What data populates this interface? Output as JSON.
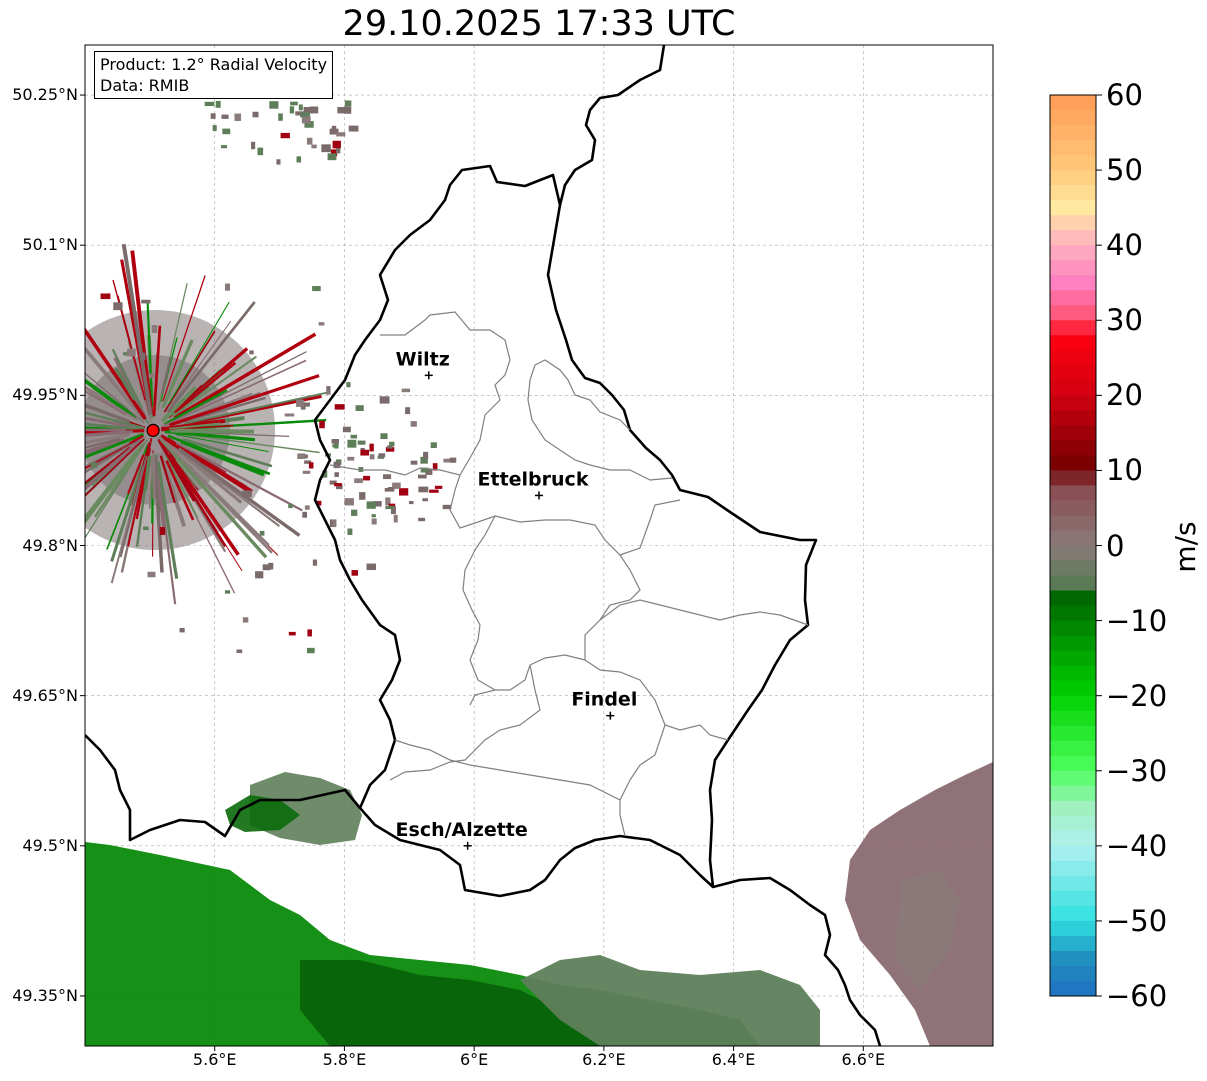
{
  "title": "29.10.2025 17:33 UTC",
  "info": {
    "product": "Product: 1.2° Radial Velocity",
    "data": "Data: RMIB"
  },
  "axes": {
    "lat_ticks": [
      "50.25°N",
      "50.1°N",
      "49.95°N",
      "49.8°N",
      "49.65°N",
      "49.5°N",
      "49.35°N"
    ],
    "lat_values": [
      50.25,
      50.1,
      49.95,
      49.8,
      49.65,
      49.5,
      49.35
    ],
    "lon_ticks": [
      "5.6°E",
      "5.8°E",
      "6°E",
      "6.2°E",
      "6.4°E",
      "6.6°E"
    ],
    "lon_values": [
      5.6,
      5.8,
      6.0,
      6.2,
      6.4,
      6.6
    ],
    "lon_range": [
      5.4,
      6.8
    ],
    "lat_range": [
      49.3,
      50.3
    ],
    "grid": true
  },
  "cities": [
    {
      "name": "Wiltz",
      "lon": 5.93,
      "lat": 49.97
    },
    {
      "name": "Ettelbruck",
      "lon": 6.1,
      "lat": 49.85
    },
    {
      "name": "Findel",
      "lon": 6.21,
      "lat": 49.63
    },
    {
      "name": "Esch/Alzette",
      "lon": 5.99,
      "lat": 49.5
    }
  ],
  "radar_site": {
    "lon": 5.505,
    "lat": 49.915
  },
  "colorbar": {
    "label": "m/s",
    "min": -60,
    "max": 60,
    "ticks": [
      "60",
      "50",
      "40",
      "30",
      "20",
      "10",
      "0",
      "−10",
      "−20",
      "−30",
      "−40",
      "−50",
      "−60"
    ],
    "stops": [
      {
        "value": 60,
        "color": "#ff9a55"
      },
      {
        "value": 50,
        "color": "#ffc97a"
      },
      {
        "value": 45,
        "color": "#ffe8a0"
      },
      {
        "value": 40,
        "color": "#ffb0c0"
      },
      {
        "value": 35,
        "color": "#ff80c0"
      },
      {
        "value": 30,
        "color": "#ff5070"
      },
      {
        "value": 28,
        "color": "#ff0010"
      },
      {
        "value": 20,
        "color": "#d00010"
      },
      {
        "value": 10,
        "color": "#700000"
      },
      {
        "value": 8,
        "color": "#8a4a50"
      },
      {
        "value": 0,
        "color": "#8a7a7a"
      },
      {
        "value": -5,
        "color": "#5a7a55"
      },
      {
        "value": -6,
        "color": "#006000"
      },
      {
        "value": -20,
        "color": "#00d000"
      },
      {
        "value": -30,
        "color": "#50ff60"
      },
      {
        "value": -35,
        "color": "#a0f0c0"
      },
      {
        "value": -40,
        "color": "#b0f0f0"
      },
      {
        "value": -50,
        "color": "#30e0e0"
      },
      {
        "value": -55,
        "color": "#2090c0"
      },
      {
        "value": -60,
        "color": "#2070c0"
      }
    ]
  },
  "colors": {
    "velocity_green_dark": "#0a6a0a",
    "velocity_green": "#0a8a0a",
    "velocity_grey_green": "#5e7e5a",
    "velocity_mauve": "#8a6a72",
    "velocity_red": "#a00010",
    "border": "#000000",
    "canton_lines": "#808080",
    "radar_site": "#ff0000"
  }
}
